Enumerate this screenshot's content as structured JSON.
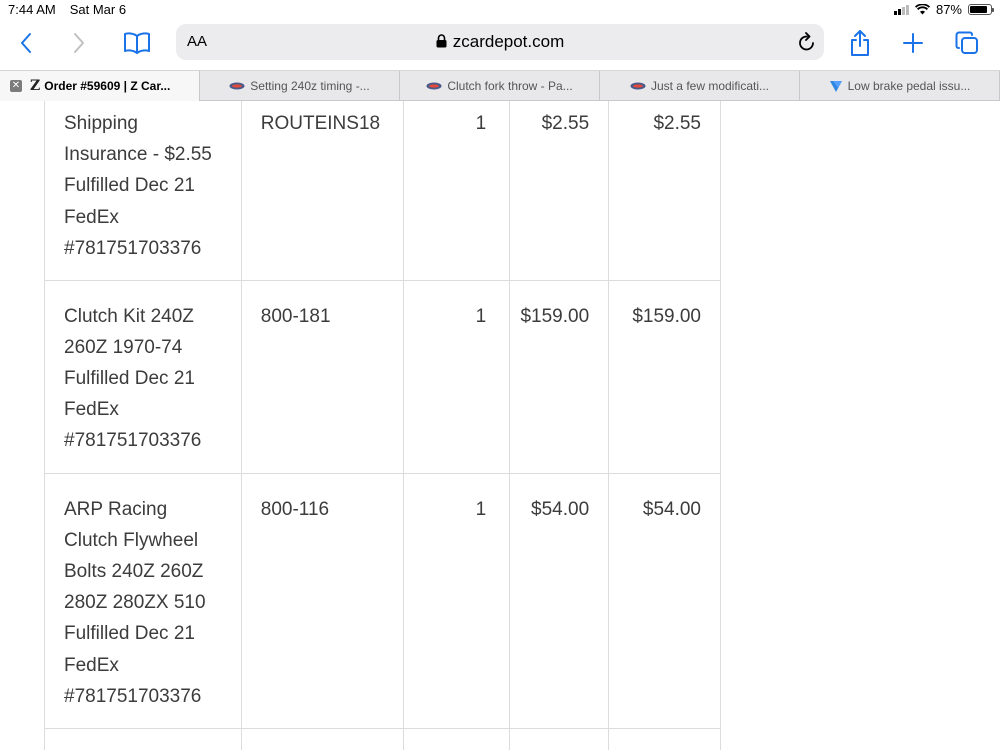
{
  "status": {
    "time": "7:44 AM",
    "date": "Sat Mar 6",
    "battery_percent": "87%",
    "battery_level": 0.87
  },
  "toolbar": {
    "text_size_label": "AA",
    "url": "zcardepot.com",
    "accent_color": "#1a73e8"
  },
  "tabs": [
    {
      "label": "Order #59609 | Z Car...",
      "active": true,
      "icon": "z-logo-icon"
    },
    {
      "label": "Setting 240z timing -...",
      "active": false,
      "icon": "forum-logo-icon"
    },
    {
      "label": "Clutch fork throw - Pa...",
      "active": false,
      "icon": "forum-logo-icon"
    },
    {
      "label": "Just a few modificati...",
      "active": false,
      "icon": "forum-logo-icon"
    },
    {
      "label": "Low brake pedal issu...",
      "active": false,
      "icon": "site-logo-icon"
    }
  ],
  "order_items": [
    {
      "name_lines": [
        "Shipping",
        "Insurance - $2.55",
        "Fulfilled Dec 21",
        "FedEx",
        "#781751703376"
      ],
      "sku": "ROUTEINS18",
      "qty": "1",
      "price": "$2.55",
      "total": "$2.55"
    },
    {
      "name_lines": [
        "Clutch Kit 240Z",
        "260Z 1970-74",
        "Fulfilled Dec 21",
        "FedEx",
        "#781751703376"
      ],
      "sku": "800-181",
      "qty": "1",
      "price": "$159.00",
      "total": "$159.00"
    },
    {
      "name_lines": [
        "ARP Racing",
        "Clutch Flywheel",
        "Bolts 240Z 260Z",
        "280Z 280ZX 510",
        "Fulfilled Dec 21",
        "FedEx",
        "#781751703376"
      ],
      "sku": "800-116",
      "qty": "1",
      "price": "$54.00",
      "total": "$54.00"
    }
  ]
}
